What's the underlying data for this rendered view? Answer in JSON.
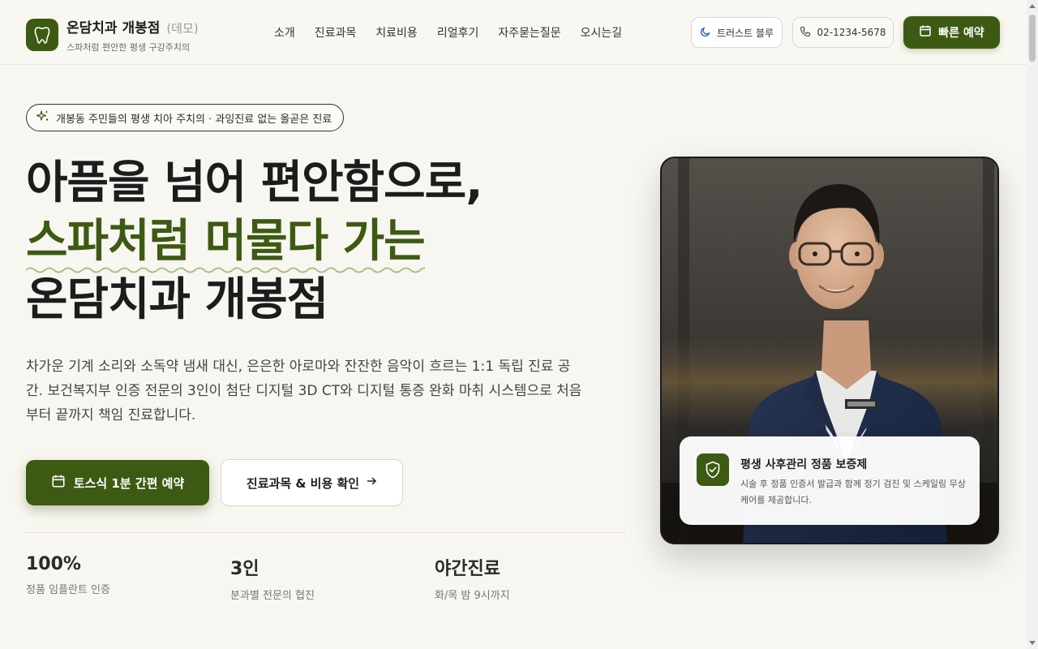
{
  "header": {
    "brand": "온담치과 개봉점",
    "brand_demo": "(데모)",
    "tagline": "스파처럼 편안한 평생 구강주치의",
    "nav": [
      "소개",
      "진료과목",
      "치료비용",
      "리얼후기",
      "자주묻는질문",
      "오시는길"
    ],
    "theme_button": "트러스트 블루",
    "phone": "02-1234-5678",
    "reserve_button": "빠른 예약"
  },
  "hero": {
    "badge": "개봉동 주민들의 평생 치아 주치의 · 과잉진료 없는 올곧은 진료",
    "title_line1": "아픔을 넘어 편안함으로,",
    "title_line2": "스파처럼 머물다 가는",
    "title_line3": "온담치과 개봉점",
    "description": "차가운 기계 소리와 소독약 냄새 대신, 은은한 아로마와 잔잔한 음악이 흐르는 1:1 독립 진료 공간. 보건복지부 인증 전문의 3인이 첨단 디지털 3D CT와 디지털 통증 완화 마취 시스템으로 처음부터 끝까지 책임 진료합니다.",
    "cta_primary": "토스식 1분 간편 예약",
    "cta_secondary": "진료과목 & 비용 확인"
  },
  "stats": [
    {
      "value": "100%",
      "label": "정품 임플란트 인증"
    },
    {
      "value": "3인",
      "label": "분과별 전문의 협진"
    },
    {
      "value": "야간진료",
      "label": "화/목 밤 9시까지"
    }
  ],
  "guarantee": {
    "title": "평생 사후관리 정품 보증제",
    "description": "시술 후 정품 인증서 발급과 함께 정기 검진 및 스케일링 무상 케어를 제공합니다."
  },
  "colors": {
    "brand_green": "#3d5a13",
    "background": "#f8f6f1"
  }
}
